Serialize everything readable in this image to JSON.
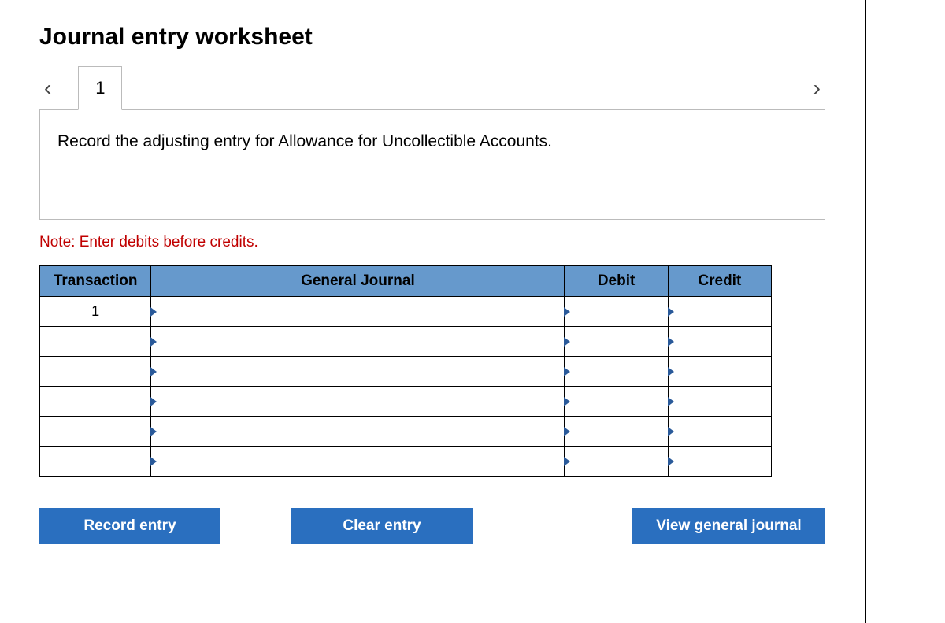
{
  "title": "Journal entry worksheet",
  "tab_label": "1",
  "instruction": "Record the adjusting entry for Allowance for Uncollectible Accounts.",
  "note": "Note: Enter debits before credits.",
  "table": {
    "headers": {
      "transaction": "Transaction",
      "general_journal": "General Journal",
      "debit": "Debit",
      "credit": "Credit"
    },
    "rows": [
      {
        "transaction": "1",
        "general_journal": "",
        "debit": "",
        "credit": ""
      },
      {
        "transaction": "",
        "general_journal": "",
        "debit": "",
        "credit": ""
      },
      {
        "transaction": "",
        "general_journal": "",
        "debit": "",
        "credit": ""
      },
      {
        "transaction": "",
        "general_journal": "",
        "debit": "",
        "credit": ""
      },
      {
        "transaction": "",
        "general_journal": "",
        "debit": "",
        "credit": ""
      },
      {
        "transaction": "",
        "general_journal": "",
        "debit": "",
        "credit": ""
      }
    ]
  },
  "buttons": {
    "record": "Record entry",
    "clear": "Clear entry",
    "view": "View general journal"
  }
}
